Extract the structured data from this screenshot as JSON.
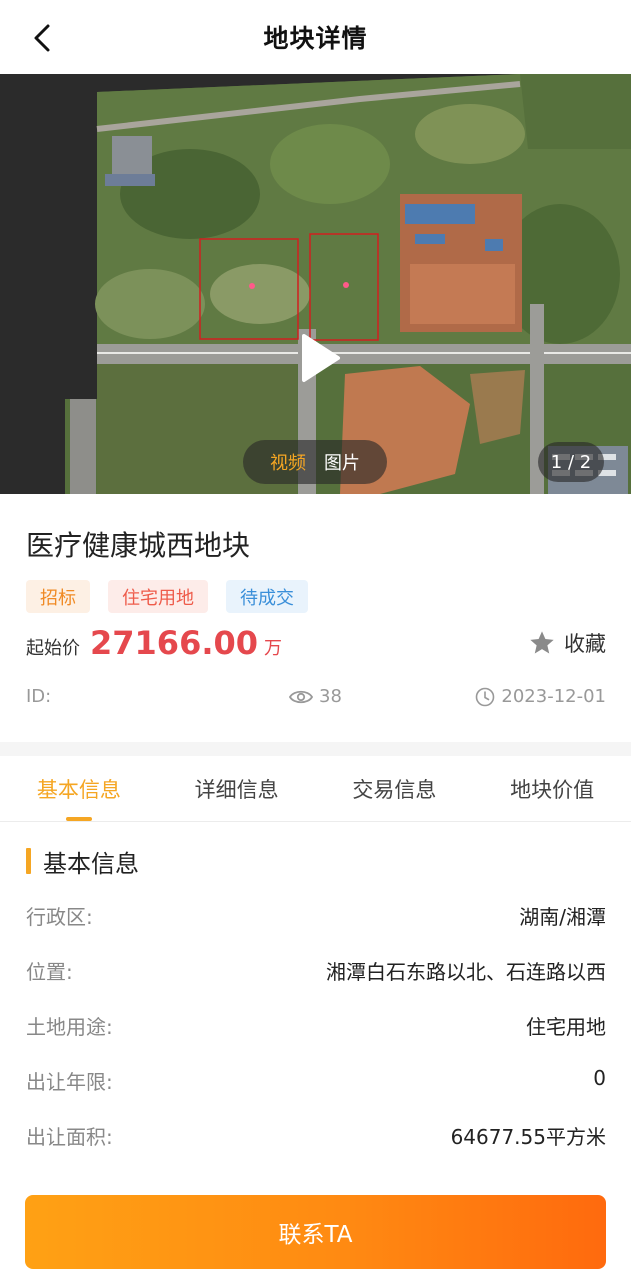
{
  "header": {
    "title": "地块详情",
    "back_icon": "chevron-left-icon"
  },
  "media": {
    "toggle_video": "视频",
    "toggle_image": "图片",
    "counter": "1 / 2",
    "accent_color": "#f5a623"
  },
  "plot": {
    "name": "医疗健康城西地块",
    "tags": [
      "招标",
      "住宅用地",
      "待成交"
    ],
    "price_label": "起始价",
    "price_value": "27166.00",
    "price_unit": "万",
    "price_color": "#e5484d",
    "favorite_label": "收藏",
    "id_label": "ID:",
    "views": "38",
    "date": "2023-12-01"
  },
  "tabs": [
    "基本信息",
    "详细信息",
    "交易信息",
    "地块价值"
  ],
  "basic": {
    "title": "基本信息",
    "rows": [
      {
        "k": "行政区:",
        "v": "湖南/湘潭"
      },
      {
        "k": "位置:",
        "v": "湘潭白石东路以北、石连路以西"
      },
      {
        "k": "土地用途:",
        "v": "住宅用地"
      },
      {
        "k": "出让年限:",
        "v": "0"
      },
      {
        "k": "出让面积:",
        "v": "64677.55平方米"
      }
    ]
  },
  "action": {
    "contact_label": "联系TA"
  }
}
